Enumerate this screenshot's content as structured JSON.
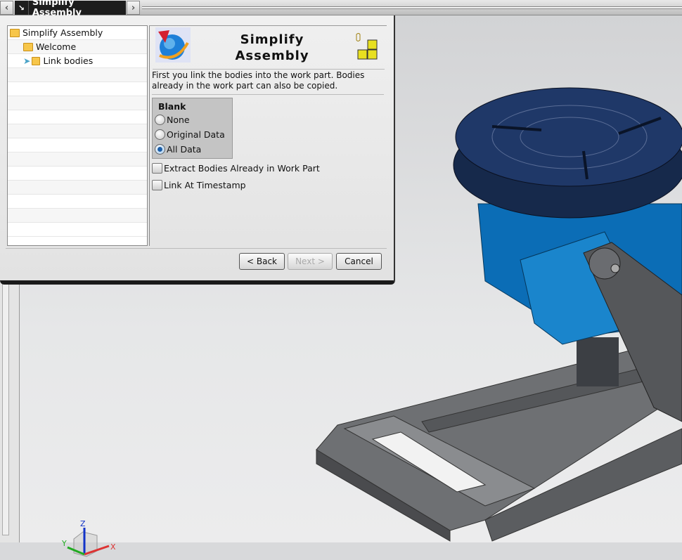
{
  "topbar": {
    "tab_title": "Simplify Assembly",
    "prev_icon": "chevron-left-icon",
    "next_icon": "chevron-right-icon",
    "pin_icon": "pin-icon"
  },
  "tree": {
    "items": [
      {
        "label": "Simplify Assembly",
        "icon": "folder-icon",
        "level": 0
      },
      {
        "label": "Welcome",
        "icon": "folder-icon",
        "level": 1
      },
      {
        "label": "Link bodies",
        "icon": "link-bodies-icon",
        "level": 1,
        "current": true
      }
    ]
  },
  "header": {
    "title_line1": "Simplify",
    "title_line2": "Assembly"
  },
  "description": "First you link the bodies into the work part. Bodies already in the work part can also be copied.",
  "blank": {
    "label": "Blank",
    "options": [
      "None",
      "Original Data",
      "All Data"
    ],
    "selected": "All Data"
  },
  "checkboxes": [
    {
      "label": "Extract Bodies Already in Work Part",
      "checked": false
    },
    {
      "label": "Link At Timestamp",
      "checked": false
    }
  ],
  "buttons": {
    "back": "< Back",
    "next": "Next >",
    "cancel": "Cancel",
    "next_enabled": false
  },
  "triad": {
    "x": "X",
    "y": "Y",
    "z": "Z"
  },
  "colors": {
    "model_blue": "#0a6fb8",
    "table_top": "#1c2f55",
    "frame_gray": "#6b6d70"
  }
}
